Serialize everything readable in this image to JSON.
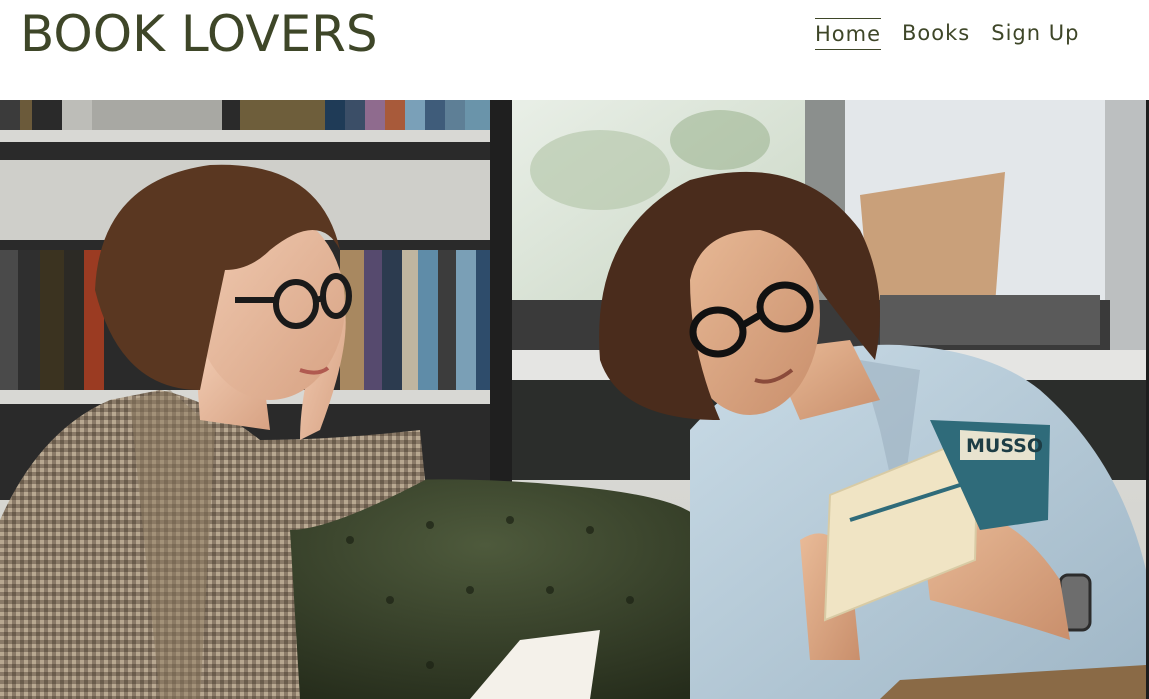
{
  "site": {
    "title": "BOOK LOVERS"
  },
  "nav": {
    "items": [
      {
        "label": "Home",
        "active": true
      },
      {
        "label": "Books",
        "active": false
      },
      {
        "label": "Sign Up",
        "active": false
      }
    ]
  },
  "hero": {
    "image_alt": "",
    "book_cover_text": "MUSSO"
  },
  "colors": {
    "brand_text": "#3e4628",
    "header_bg": "#ffffff"
  }
}
